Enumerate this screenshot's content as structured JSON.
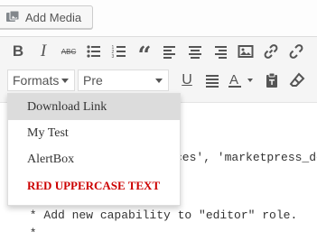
{
  "add_media": {
    "label": "Add Media"
  },
  "toolbar": {
    "row1_icons": [
      "bold-icon",
      "italic-icon",
      "strikethrough-icon",
      "bullet-list-icon",
      "numbered-list-icon",
      "blockquote-icon",
      "align-left-icon",
      "align-center-icon",
      "align-right-icon",
      "image-icon",
      "link-icon",
      "unlink-icon"
    ],
    "formats_label": "Formats",
    "format_select_value": "Pre",
    "row2_icons": [
      "underline-icon",
      "justify-icon",
      "text-color-icon",
      "paste-text-icon",
      "clear-formatting-icon"
    ]
  },
  "content": {
    "line1": "ces', 'marketpress_dea",
    "line2": " * Add new capability to \"editor\" role.",
    "line3": " *"
  },
  "formats_menu": {
    "items": [
      {
        "label": "Download Link",
        "active": true
      },
      {
        "label": "My Test"
      },
      {
        "label": "AlertBox"
      },
      {
        "label": "Red Uppercase Text",
        "color": "#cc0000"
      }
    ]
  }
}
